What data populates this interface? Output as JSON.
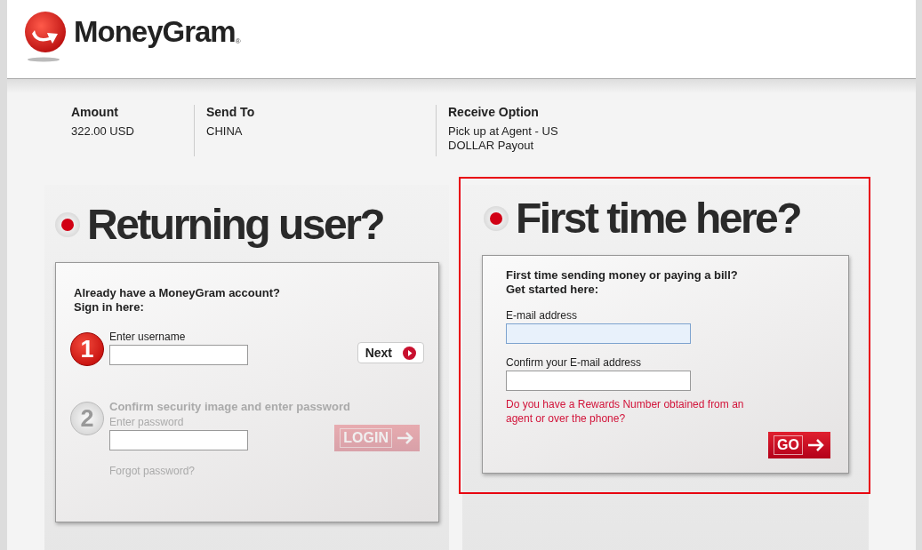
{
  "header": {
    "logo_text": "MoneyGram",
    "logo_mark": "®"
  },
  "summary": [
    {
      "label": "Amount",
      "value": "322.00 USD"
    },
    {
      "label": "Send To",
      "value": "CHINA"
    },
    {
      "label": "Receive Option",
      "value": "Pick up at Agent - US DOLLAR Payout"
    }
  ],
  "returning": {
    "title": "Returning user?",
    "intro": "Already have a MoneyGram account?",
    "intro2": "Sign in here:",
    "steps": [
      {
        "kind": "next",
        "number": "1",
        "active": true,
        "label": "Enter username",
        "button": "Next"
      },
      {
        "kind": "arrow",
        "number": "2",
        "active": false,
        "heading": "Confirm security image and enter password",
        "label": "Enter password",
        "button": "LOGIN"
      }
    ],
    "forgot": "Forgot password?"
  },
  "first_time": {
    "highlighted": true,
    "title": "First time here?",
    "intro": "First time sending money or paying a bill?",
    "intro2": "Get started here:",
    "fields": [
      {
        "label": "E-mail address",
        "focused": true
      },
      {
        "label": "Confirm your E-mail address",
        "focused": false
      }
    ],
    "rewards_link": "Do you have a Rewards Number obtained from an agent or over the phone?",
    "button": "GO"
  }
}
